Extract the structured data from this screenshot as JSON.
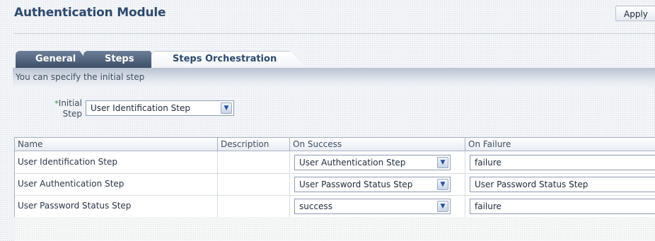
{
  "header": {
    "title": "Authentication Module",
    "apply_label": "Apply"
  },
  "tabs": [
    {
      "label": "General",
      "selected": false
    },
    {
      "label": "Steps",
      "selected": false
    },
    {
      "label": "Steps Orchestration",
      "selected": true
    }
  ],
  "info_text": "You can specify the initial step",
  "initial_step": {
    "required_marker": "*",
    "label_line1": "Initial",
    "label_line2": "Step",
    "value": "User Identification Step"
  },
  "table": {
    "columns": [
      "Name",
      "Description",
      "On Success",
      "On Failure"
    ],
    "rows": [
      {
        "name": "User Identification Step",
        "description": "",
        "on_success": "User Authentication Step",
        "on_failure": "failure"
      },
      {
        "name": "User Authentication Step",
        "description": "",
        "on_success": "User Password Status Step",
        "on_failure": "User Password Status Step"
      },
      {
        "name": "User Password Status Step",
        "description": "",
        "on_success": "success",
        "on_failure": "failure"
      }
    ]
  },
  "icons": {
    "dropdown": "chevron-down-icon"
  },
  "colors": {
    "title": "#2e4a6d",
    "tab_inactive": "#4a5c76",
    "required": "#2e7d32"
  }
}
